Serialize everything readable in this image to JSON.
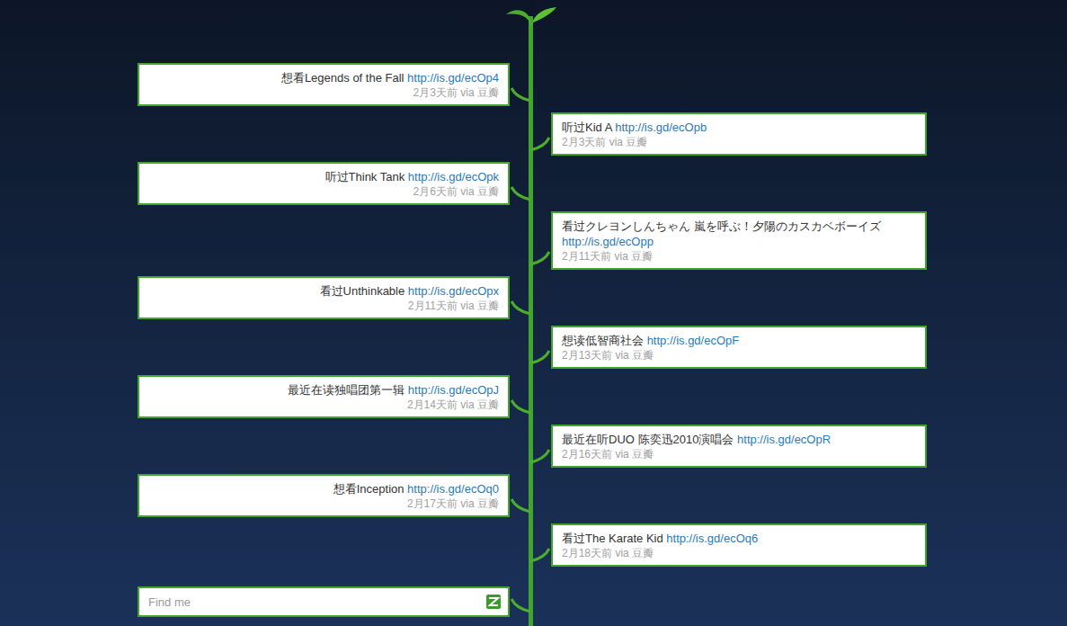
{
  "timeline": [
    {
      "text": "想看Legends of the Fall",
      "link": "http://is.gd/ecOp4",
      "time": "2月3天前",
      "source": "via 豆瓣"
    },
    {
      "text": "听过Kid A",
      "link": "http://is.gd/ecOpb",
      "time": "2月3天前",
      "source": "via 豆瓣"
    },
    {
      "text": "听过Think Tank",
      "link": "http://is.gd/ecOpk",
      "time": "2月6天前",
      "source": "via 豆瓣"
    },
    {
      "text": "看过クレヨンしんちゃん 嵐を呼ぶ！夕陽のカスカベボーイズ",
      "link": "http://is.gd/ecOpp",
      "time": "2月11天前",
      "source": "via 豆瓣"
    },
    {
      "text": "看过Unthinkable",
      "link": "http://is.gd/ecOpx",
      "time": "2月11天前",
      "source": "via 豆瓣"
    },
    {
      "text": "想读低智商社会",
      "link": "http://is.gd/ecOpF",
      "time": "2月13天前",
      "source": "via 豆瓣"
    },
    {
      "text": "最近在读独唱团第一辑",
      "link": "http://is.gd/ecOpJ",
      "time": "2月14天前",
      "source": "via 豆瓣"
    },
    {
      "text": "最近在听DUO 陈奕迅2010演唱会",
      "link": "http://is.gd/ecOpR",
      "time": "2月16天前",
      "source": "via 豆瓣"
    },
    {
      "text": "想看Inception",
      "link": "http://is.gd/ecOq0",
      "time": "2月17天前",
      "source": "via 豆瓣"
    },
    {
      "text": "看过The Karate Kid",
      "link": "http://is.gd/ecOq6",
      "time": "2月18天前",
      "source": "via 豆瓣"
    }
  ],
  "search": {
    "placeholder": "Find me"
  }
}
